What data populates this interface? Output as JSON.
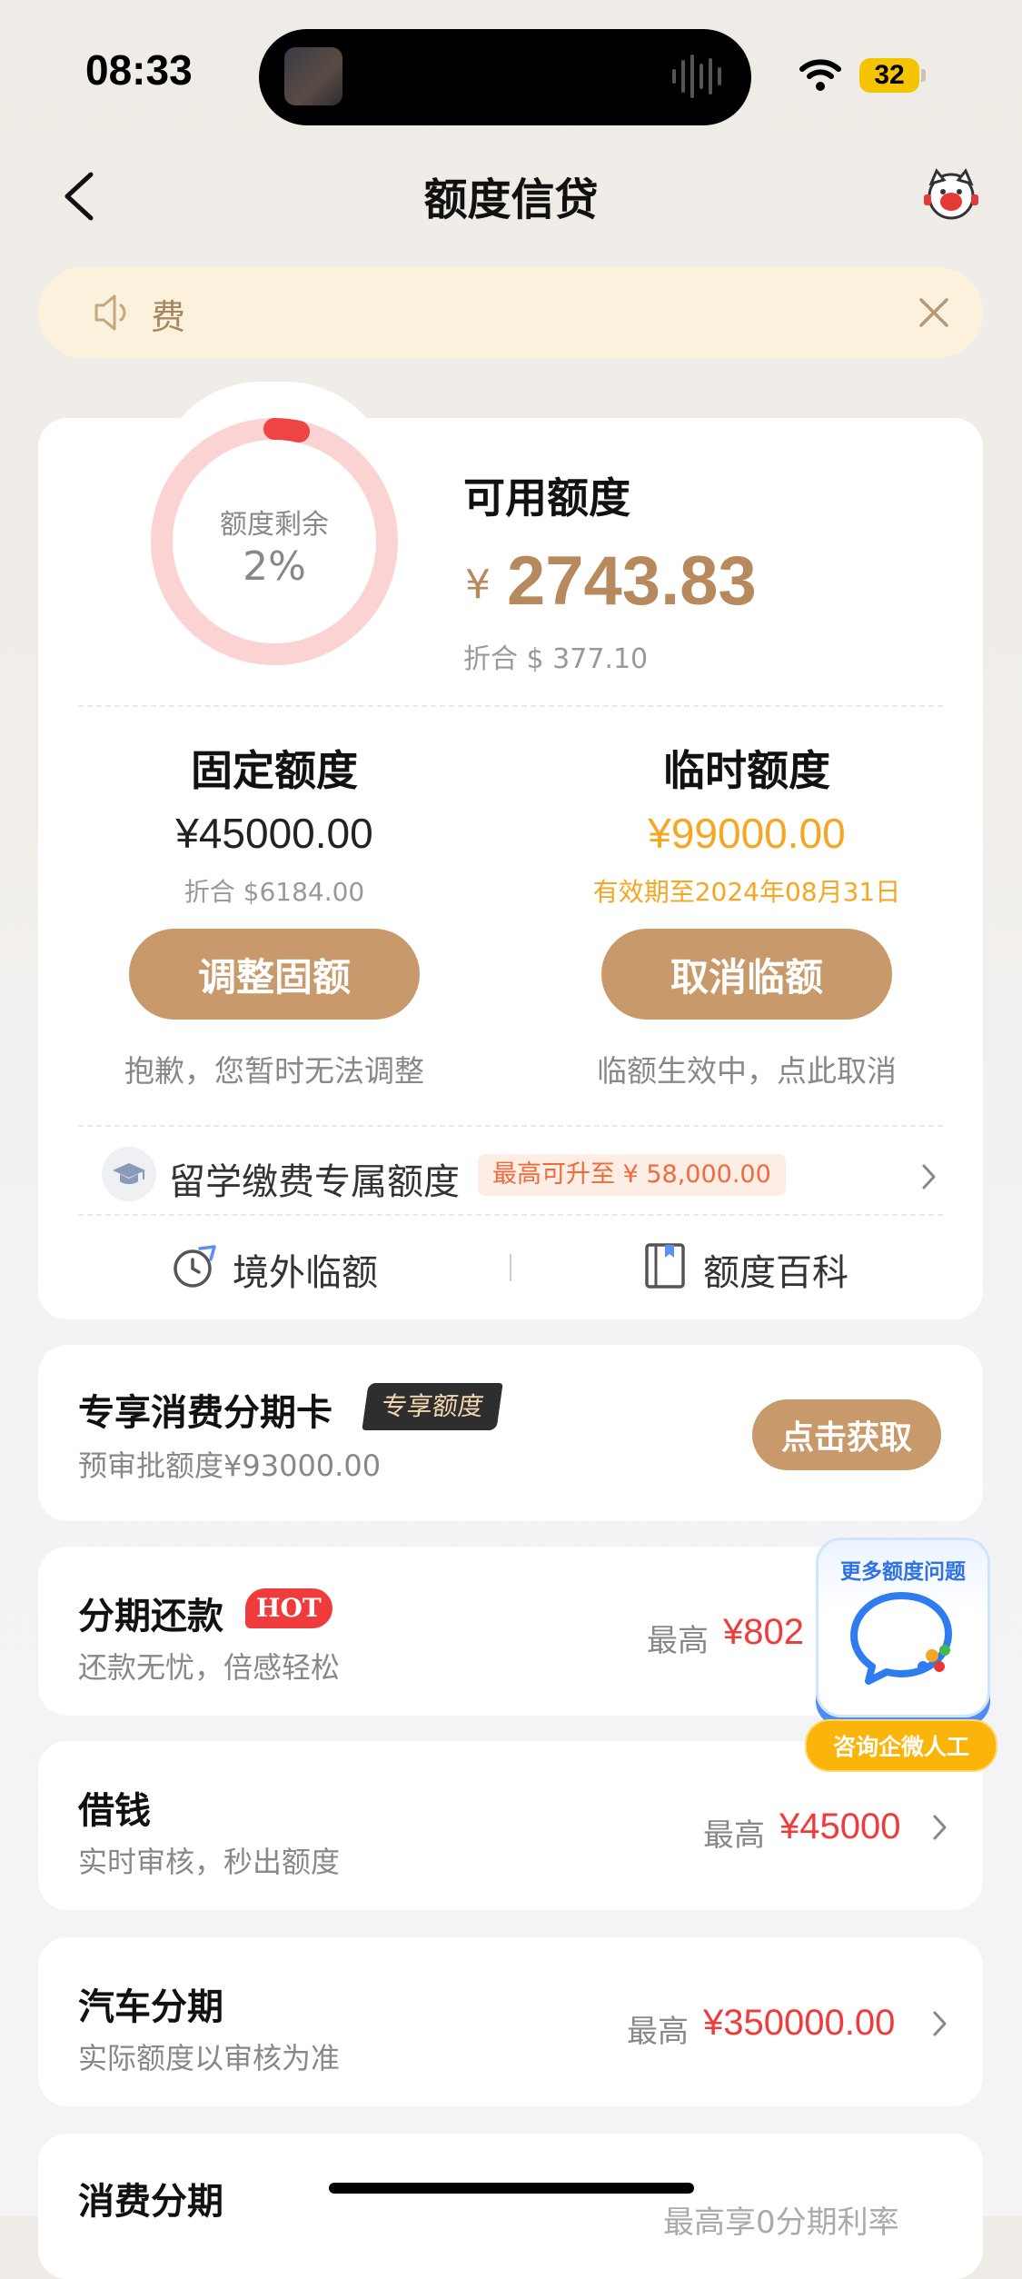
{
  "status_bar": {
    "time": "08:33",
    "battery": "32"
  },
  "header": {
    "title": "额度信贷"
  },
  "notice": {
    "text": "费"
  },
  "credit": {
    "ring_label": "额度剩余",
    "ring_percent_text": "2%",
    "remaining_fraction": 0.02,
    "available_label": "可用额度",
    "currency_symbol": "¥",
    "available_amount": "2743.83",
    "available_usd": "折合 $ 377.10"
  },
  "fixed": {
    "title": "固定额度",
    "amount": "¥45000.00",
    "usd": "折合 $6184.00",
    "button": "调整固额",
    "note": "抱歉，您暂时无法调整"
  },
  "temp": {
    "title": "临时额度",
    "amount": "¥99000.00",
    "validity": "有效期至2024年08月31日",
    "button": "取消临额",
    "note": "临额生效中，点此取消"
  },
  "study": {
    "label": "留学缴费专属额度",
    "badge": "最高可升至 ¥ 58,000.00"
  },
  "tools": {
    "overseas": "境外临额",
    "wiki": "额度百科"
  },
  "exclusive_card": {
    "title": "专享消费分期卡",
    "tag": "专享额度",
    "subtitle": "预审批额度¥93000.00",
    "button": "点击获取"
  },
  "products": [
    {
      "title": "分期还款",
      "tag": "HOT",
      "subtitle": "还款无忧，倍感轻松",
      "prefix": "最高",
      "amount": "¥802"
    },
    {
      "title": "借钱",
      "subtitle": "实时审核，秒出额度",
      "prefix": "最高",
      "amount": "¥45000"
    },
    {
      "title": "汽车分期",
      "subtitle": "实际额度以审核为准",
      "prefix": "最高",
      "amount": "¥350000.00"
    },
    {
      "title": "消费分期",
      "extra": "最高享0分期利率"
    }
  ],
  "float_help": {
    "title": "更多额度问题",
    "button": "咨询企微人工"
  },
  "colors": {
    "accent": "#c8996a",
    "gold_text": "#b68a5d",
    "temp_amount": "#f5a623",
    "price_red": "#ef3b3b",
    "ring_track": "#fbd3d3",
    "ring_fill": "#ef4444"
  }
}
